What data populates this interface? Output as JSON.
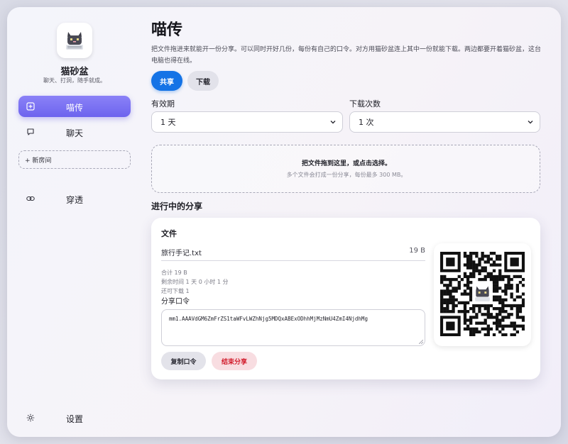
{
  "sidebar": {
    "app_name": "猫砂盆",
    "tagline": "聊天、打洞，随手就成。",
    "items": [
      {
        "label": "喵传",
        "icon": "share-box-icon",
        "active": true
      },
      {
        "label": "聊天",
        "icon": "chat-bubble-icon",
        "active": false
      },
      {
        "label": "穿透",
        "icon": "link-icon",
        "active": false
      }
    ],
    "new_room_label": "+ 新房间",
    "settings_label": "设置",
    "settings_icon": "gear-icon"
  },
  "main": {
    "title": "喵传",
    "description": "把文件拖进来就能开一份分享。可以同时开好几份，每份有自己的口令。对方用猫砂盆连上其中一份就能下载。两边都要开着猫砂盆，这台电脑也得在线。",
    "tabs": [
      {
        "label": "共享",
        "active": true
      },
      {
        "label": "下载",
        "active": false
      }
    ],
    "expiry": {
      "label": "有效期",
      "value": "1 天"
    },
    "download_count": {
      "label": "下载次数",
      "value": "1 次"
    },
    "dropzone": {
      "main": "把文件拖到这里，或点击选择。",
      "sub": "多个文件会打成一份分享，每份最多 300 MB。"
    },
    "active_section_title": "进行中的分享",
    "share_card": {
      "heading": "文件",
      "file_name": "旅行手记.txt",
      "file_size": "19 B",
      "total": "合计 19 B",
      "remaining_time": "剩余时间 1 天 0 小时 1 分",
      "downloads_left": "还可下载 1",
      "code_label": "分享口令",
      "code": "mm1.AAAVdGM6ZmFrZS1taWFvLWZhNjg5MDQxABExODhhMjMzNmU4ZmI4NjdhMg",
      "copy_label": "复制口令",
      "end_label": "结束分享"
    }
  },
  "colors": {
    "accent_blue": "#1473e6",
    "nav_active": "#7469f0",
    "danger": "#d11a2a"
  }
}
